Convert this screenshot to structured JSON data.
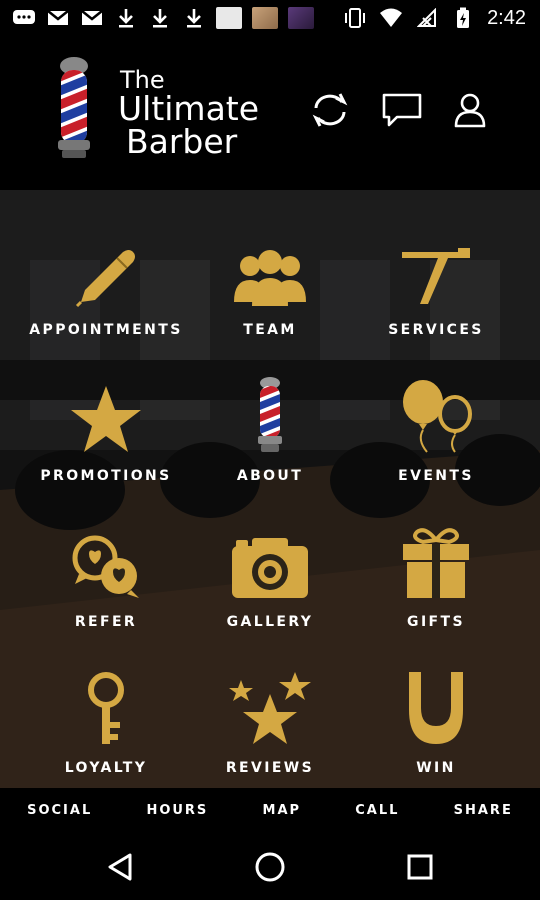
{
  "status_bar": {
    "time": "2:42",
    "left_icons": [
      "chat-bubble-icon",
      "gmail-icon",
      "gmail-icon",
      "download-icon",
      "download-icon",
      "download-icon",
      "image-thumbnail",
      "image-thumbnail",
      "image-thumbnail"
    ],
    "right_icons": [
      "vibrate-icon",
      "wifi-icon",
      "no-signal-icon",
      "battery-charging-icon"
    ]
  },
  "header": {
    "logo_line1": "The",
    "logo_line2": "Ultimate",
    "logo_line3": "Barber",
    "actions": [
      "refresh-icon",
      "message-icon",
      "profile-icon"
    ]
  },
  "accent_color": "#d4a843",
  "tiles": [
    {
      "label": "APPOINTMENTS",
      "icon": "pen-icon"
    },
    {
      "label": "TEAM",
      "icon": "team-icon"
    },
    {
      "label": "SERVICES",
      "icon": "razor-icon"
    },
    {
      "label": "PROMOTIONS",
      "icon": "star-icon"
    },
    {
      "label": "ABOUT",
      "icon": "barber-pole-icon"
    },
    {
      "label": "EVENTS",
      "icon": "balloons-icon"
    },
    {
      "label": "REFER",
      "icon": "refer-hearts-icon"
    },
    {
      "label": "GALLERY",
      "icon": "camera-icon"
    },
    {
      "label": "GIFTS",
      "icon": "gift-icon"
    },
    {
      "label": "LOYALTY",
      "icon": "key-icon"
    },
    {
      "label": "REVIEWS",
      "icon": "stars-icon"
    },
    {
      "label": "WIN",
      "icon": "horseshoe-icon"
    }
  ],
  "bottom_links": [
    "SOCIAL",
    "HOURS",
    "MAP",
    "CALL",
    "SHARE"
  ],
  "nav_bar": [
    "back-icon",
    "home-icon",
    "recents-icon"
  ]
}
